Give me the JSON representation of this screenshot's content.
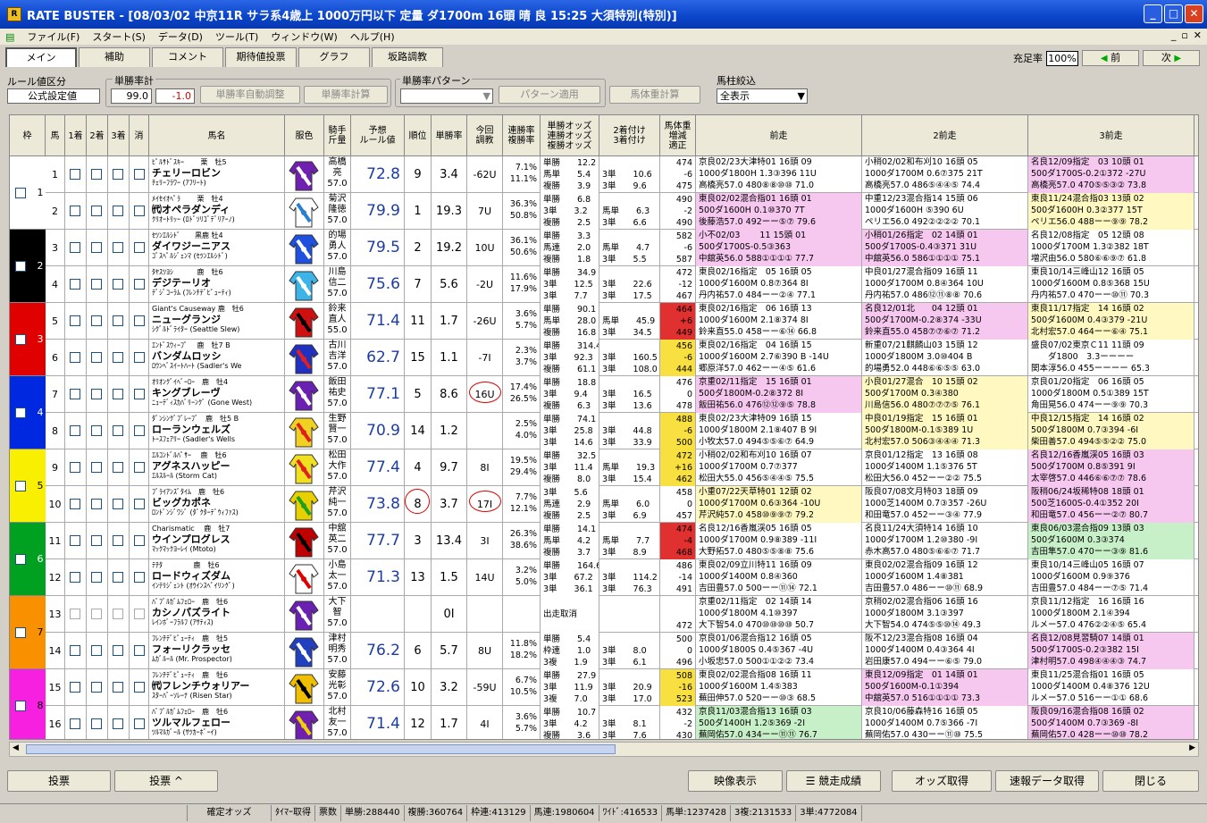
{
  "title": "RATE BUSTER - [08/03/02 中京11R サラ系4歳上 1000万円以下 定量 ダ1700m 16頭 晴 良 15:25 大須特別(特別)]",
  "menu": [
    "ファイル(F)",
    "スタート(S)",
    "データ(D)",
    "ツール(T)",
    "ウィンドウ(W)",
    "ヘルプ(H)"
  ],
  "tabs": [
    "メイン",
    "補助",
    "コメント",
    "期待値投票",
    "グラフ",
    "坂路調教"
  ],
  "fill_label": "充足率",
  "fill_value": "100%",
  "prev_label": "前",
  "next_label": "次",
  "rule_label": "ルール値区分",
  "rule_value": "公式設定値",
  "winrate_total_label": "単勝率計",
  "winrate_total": "99.0",
  "winrate_diff": "-1.0",
  "auto_adjust": "単勝率自動調整",
  "winrate_calc": "単勝率計算",
  "pattern_label": "単勝率パターン",
  "pattern_apply": "パターン適用",
  "weight_calc": "馬体重計算",
  "filter_label": "馬柱絞込",
  "filter_value": "全表示",
  "headers": {
    "waku": "枠",
    "uma": "馬",
    "p1": "1着",
    "p2": "2着",
    "p3": "3着",
    "kesi": "消",
    "name": "馬名",
    "silk": "服色",
    "jockey": "騎手\n斤量",
    "rule": "予想\nルール値",
    "rank": "順位",
    "win": "単勝率",
    "chokyo": "今回\n調教",
    "rentan": "連勝率\n複勝率",
    "odds": "単勝オッズ\n連勝オッズ\n複勝オッズ",
    "odds2": "2着付け\n3着付け",
    "weight": "馬体重\n増減\n適正",
    "prev1": "前走",
    "prev2": "2前走",
    "prev3": "3前走"
  },
  "horses": [
    {
      "no": "1",
      "sire": "ﾋﾟﾙｻﾄﾞｽｷｰ　　 栗　牡5",
      "name": "チェリーロビン",
      "dam": "ﾁｪﾘｰﾌﾗﾜｰ (ｱﾌﾘｰﾄ)",
      "jockey": "高橋\n亮\n57.0",
      "rule": "72.8",
      "rank": "9",
      "win": "3.4",
      "chokyo": "-62U",
      "rentan": "7.1%\n11.1%",
      "odds": "単勝　　12.2\n馬単　　5.4\n複勝　　3.9",
      "odds2": "\n3単　　10.6\n3単　　9.6",
      "weight": "474\n-6\n475",
      "p1": "京良02/23大津特01 16頭 09\n1000ダ1800H 1.3③396 11U\n高橋亮57.0 480⑧⑧⑩⑩ 71.0",
      "p2": "小稍02/02和布刈10 16頭 05\n1000ダ1700M 0.6⑦375 21T\n高橋亮57.0 486⑤④④⑤ 74.4",
      "p3": "名良12/09指定　03 10頭 01\n500ダ1700S-0.2①372 -27U\n高橋亮57.0 470⑤⑤③② 73.8",
      "c1": "",
      "c2": "",
      "c3": "#f6c8f0"
    },
    {
      "no": "2",
      "sire": "ﾒｲｾｲｵﾍﾟﾗ　　 栗　牡4",
      "name": "㈹オペラダンディ",
      "dam": "ｸﾘｵｰﾄﾘｯｰ (ﾛﾄﾞｿﾘｺﾞﾃﾞﾘｱｰﾉ)",
      "jockey": "菊沢\n隆徳\n57.0",
      "rule": "79.9",
      "rank": "1",
      "win": "19.3",
      "chokyo": "7U",
      "rentan": "36.3%\n50.8%",
      "odds": "単勝　　6.8\n3単　　3.2\n複勝　　2.5",
      "odds2": "\n馬単　　6.3\n3単　　6.6",
      "weight": "490\n-2\n490",
      "p1": "東良02/02混合指01 16頭 01\n500ダ1600H 0.1⑩370 7T\n後藤浩57.0 492ーー⑤⑦ 79.6",
      "p2": "中重12/23混合指14 15頭 06\n1000ダ1600H ⑤390 6U\nペリエ56.0 492②②②② 70.1",
      "p3": "東良11/24混合指03 13頭 02\n500ダ1600H 0.3②377 15T\nペリエ56.0 488ーー⑨⑨ 78.2",
      "c1": "#f6c8f0",
      "c2": "",
      "c3": "#fff8c0"
    },
    {
      "no": "3",
      "sire": "ｾﾂﾝｴﾙｼﾄﾞ　　黒鹿 牡4",
      "name": "ダイワジーニアス",
      "dam": "ｺﾞｽﾍﾟﾙｼﾞｪﾝﾏ (ｾﾂﾝｴﾙｼﾄﾞ)",
      "jockey": "的場\n勇人\n57.0",
      "rule": "79.5",
      "rank": "2",
      "win": "19.2",
      "chokyo": "10U",
      "rentan": "36.1%\n50.6%",
      "odds": "単勝　　3.3\n馬連　　2.0\n複勝　　1.8",
      "odds2": "\n馬単　　4.7\n3単　　5.5",
      "weight": "582\n-6\n587",
      "p1": "小不02/03　　 11 15頭 01\n500ダ1700S-0.5③363\n中舘英56.0 588①①①① 77.7",
      "p2": "小稍01/26指定　02 14頭 01\n500ダ1700S-0.4③371 31U\n中舘英56.0 586①①①① 75.1",
      "p3": "名良12/08指定　05 12頭 08\n1000ダ1700M 1.3②382 18T\n増沢由56.0 580⑥⑥⑨⑦ 61.8",
      "c1": "#f6c8f0",
      "c2": "#f6c8f0",
      "c3": ""
    },
    {
      "no": "4",
      "sire": "ﾀﾔｽﾂﾖｼ　　　 鹿　牡6",
      "name": "デジテーリオ",
      "dam": "ﾃﾞｼﾞｺｰﾗﾑ (ﾌﾚﾝﾁﾃﾞﾋﾟｭｰﾃｨ)",
      "jockey": "川島\n信二\n57.0",
      "rule": "75.6",
      "rank": "7",
      "win": "5.6",
      "chokyo": "-2U",
      "rentan": "11.6%\n17.9%",
      "odds": "単勝　　34.9\n3単　　12.5\n3単　　7.7",
      "odds2": "\n3単　　22.6\n3単　　17.5",
      "weight": "472\n-12\n467",
      "p1": "東良02/16指定　05 16頭 05\n1000ダ1600M 0.8⑦364 8I\n丹内祐57.0 484ーー②④ 77.1",
      "p2": "中良01/27混合指09 16頭 11\n1000ダ1700M 0.8④364 10U\n丹内祐57.0 486⑫⑪⑧⑧ 70.6",
      "p3": "東良10/14三峰山12 16頭 05\n1000ダ1600M 0.8⑤368 15U\n丹内祐57.0 470ーー⑩⑪ 70.3",
      "c1": "",
      "c2": "",
      "c3": ""
    },
    {
      "no": "5",
      "sire": "Giant's Causeway 鹿　牡6",
      "name": "ニューグランジ",
      "dam": "ｼｸﾞﾙﾄﾞﾗｲﾀｰ (Seattle Slew)",
      "jockey": "鈴来\n直人\n55.0",
      "rule": "71.4",
      "rank": "11",
      "win": "1.7",
      "chokyo": "-26U",
      "rentan": "3.6%\n5.7%",
      "odds": "単勝　　90.1\n馬単　　28.0\n複勝　　16.8",
      "odds2": "\n馬単　　45.9\n3単　　34.5",
      "weight": "464\n+6\n449",
      "p1": "東良02/16指定　06 16頭 13\n1000ダ1600M 2.1⑧374 8I\n鈴来直55.0 458ーー⑥⑭ 66.8",
      "p2": "名良12/01北　　04 12頭 01\n500ダ1700M-0.2⑧374 -33U\n鈴来直55.0 458⑦⑦⑥⑦ 71.2",
      "p3": "東良11/17指定　14 16頭 02\n500ダ1600M 0.4③379 -21U\n北村宏57.0 464ーー⑥④ 75.1",
      "c1": "",
      "c2": "#f6c8f0",
      "c3": "#fff8c0",
      "wc": "#e03030"
    },
    {
      "no": "6",
      "sire": "ｴﾝﾄﾞｽｳｨｰﾌﾟ　 鹿　牡7 B",
      "name": "バンダムロッシ",
      "dam": "ﾛｳﾝﾍﾞｽｲｰﾄﾊｰﾄ (Sadler's We",
      "jockey": "古川\n吉洋\n57.0",
      "rule": "62.7",
      "rank": "15",
      "win": "1.1",
      "chokyo": "-7I",
      "rentan": "2.3%\n3.7%",
      "odds": "単勝　　314.4\n3単　　92.3\n複勝　　61.1",
      "odds2": "\n3単　　160.5\n3単　　108.0",
      "weight": "456\n-6\n444",
      "p1": "東良02/16指定　04 16頭 15\n1000ダ1600M 2.7⑥390 B -14U\n郷原洋57.0 462ーー④⑤ 61.6",
      "p2": "新重07/21麒麟山03 15頭 12\n1000ダ1800M 3.0⑩404 B\n的場勇52.0 448⑥⑥⑤⑤ 63.0",
      "p3": "盛良07/02東京Ｃ11 11頭 09\n　　ダ1800　3.3ーーーー\n関本淳56.0 455ーーーー 65.3",
      "c1": "",
      "c2": "",
      "c3": "",
      "wc": "#f8e040"
    },
    {
      "no": "7",
      "sire": "ｵﾘｵﾝｸﾞｲﾍﾞｰﾛｰ　鹿　牡4",
      "name": "キングブレーヴ",
      "dam": "ﾆｭｰﾃﾞｨｽｶﾊﾞﾘｰﾝｸﾞ (Gone West)",
      "jockey": "飯田\n祐史\n57.0",
      "rule": "77.1",
      "rank": "5",
      "win": "8.6",
      "chokyo": "16U",
      "rentan": "17.4%\n26.5%",
      "odds": "単勝　　18.8\n3単　　9.4\n複勝　　6.3",
      "odds2": "\n3単　　16.5\n3単　　13.6",
      "weight": "476\n0\n478",
      "p1": "京重02/11指定　15 16頭 01\n500ダ1800M-0.2⑧372 8I\n飯田祐56.0 476⑫⑫⑨⑤ 78.8",
      "p2": "小良01/27混合　10 15頭 02\n500ダ1700M 0.3④380\n川島信56.0 480⑦⑦⑦⑤ 76.1",
      "p3": "京良01/20指定　06 16頭 05\n1000ダ1800M 0.5①389 15T\n角田晃56.0 474ーー⑨⑨ 70.3",
      "c1": "#f6c8f0",
      "c2": "#fff8c0",
      "c3": ""
    },
    {
      "no": "8",
      "sire": "ﾀﾞﾝｼﾝｸﾞﾌﾞﾚｰﾌﾞ　鹿　牡5 B",
      "name": "ローランウェルズ",
      "dam": "ﾄｰｽﾌｪｱﾘｰ (Sadler's Wells",
      "jockey": "生野\n賢一\n57.0",
      "rule": "70.9",
      "rank": "14",
      "win": "1.2",
      "chokyo": "",
      "rentan": "2.5%\n4.0%",
      "odds": "単勝　　74.1\n3単　　25.8\n3単　　14.6",
      "odds2": "\n3単　　44.8\n3単　　33.9",
      "weight": "488\n-6\n500",
      "p1": "東良02/23大津特09 16頭 15\n1000ダ1800M 2.1⑧407 B 9I\n小牧太57.0 494⑤⑤⑥⑦ 64.9",
      "p2": "中良01/19指定　15 16頭 01\n500ダ1800M-0.1⑤389 1U\n北村宏57.0 506③④④④ 71.3",
      "p3": "中良12/15指定　14 16頭 02\n500ダ1800M 0.7③394 -6I\n柴田善57.0 494⑤⑤②② 75.0",
      "c1": "",
      "c2": "#fff8c0",
      "c3": "#fff8c0",
      "wc": "#f8e040"
    },
    {
      "no": "9",
      "sire": "ｴﾙｺﾝﾄﾞﾙﾊﾟｻｰ　 鹿　牡6",
      "name": "アグネスハッピー",
      "dam": "ｴﾙｽﾙｰﾙ (Storm Cat)",
      "jockey": "松田\n大作\n57.0",
      "rule": "77.4",
      "rank": "4",
      "win": "9.7",
      "chokyo": "8I",
      "rentan": "19.5%\n29.4%",
      "odds": "単勝　　32.5\n3単　　11.4\n複勝　　8.0",
      "odds2": "\n馬単　　19.3\n3単　　15.4",
      "weight": "472\n+16\n462",
      "p1": "小稍02/02和布刈10 16頭 07\n1000ダ1700M 0.7⑦377\n松田大55.0 456⑤④④⑤ 75.5",
      "p2": "京良01/12指定　13 16頭 08\n1000ダ1400M 1.1⑤376 5T\n松田大56.0 452ーー②② 75.5",
      "p3": "名良12/16香嵐渓05 16頭 03\n500ダ1700M 0.8⑤391 9I\n太宰啓57.0 446⑥⑥⑦⑦ 78.6",
      "c1": "",
      "c2": "",
      "c3": "#f6c8f0",
      "wc": "#f8e040"
    },
    {
      "no": "10",
      "sire": "ﾌﾞﾗｲｱﾝｽﾞﾀｲﾑ　鹿　牡6",
      "name": "ビッグカポネ",
      "dam": "ﾛﾝﾄﾞﾝｼﾞﾜｼﾞ (ﾀﾞｸﾀｰﾃﾞｳｨﾌｧｽ)",
      "jockey": "芹沢\n純一\n57.0",
      "rule": "73.8",
      "rank": "8",
      "win": "3.7",
      "chokyo": "17I",
      "rentan": "7.7%\n12.1%",
      "odds": "3単　　5.6\n馬連　　2.9\n複勝　　2.5",
      "odds2": "\n馬単　　6.0\n3単　　6.9",
      "weight": "458\n0\n457",
      "p1": "小重07/22天草特01 12頭 02\n1000ダ1700M 0.6③364 -10U\n芹沢純57.0 458⑩⑨⑨⑦ 79.2",
      "p2": "阪良07/08文月特03 18頭 09\n1000芝1400M 0.7③357 -26U\n和田竜57.0 452ーー③④ 77.9",
      "p3": "阪稍06/24坂稀特08 18頭 01\n500芝1600S-0.4①352 20I\n和田竜57.0 456ーー②⑦ 80.7",
      "c1": "#fff8c0",
      "c2": "",
      "c3": "#f6c8f0"
    },
    {
      "no": "11",
      "sire": "Charismatic　 鹿　牡7",
      "name": "ウインプログレス",
      "dam": "ﾏｯｸﾏｯｸﾖｰﾚｲ (Mtoto)",
      "jockey": "中舘\n英二\n57.0",
      "rule": "77.7",
      "rank": "3",
      "win": "13.4",
      "chokyo": "3I",
      "rentan": "26.3%\n38.6%",
      "odds": "単勝　　14.1\n馬単　　4.2\n複勝　　3.7",
      "odds2": "\n馬単　　7.7\n3単　　8.9",
      "weight": "474\n-4\n468",
      "p1": "名良12/16香嵐渓05 16頭 05\n1000ダ1700M 0.9⑧389 -11I\n大野拓57.0 480⑤⑤⑧⑧ 75.6",
      "p2": "名良11/24大須特14 16頭 10\n1000ダ1700M 1.2⑩380 -9I\n赤木高57.0 480⑤⑥⑥⑦ 71.7",
      "p3": "東良06/03混合指09 13頭 03\n500ダ1600M 0.3③374\n吉田隼57.0 470ーー③⑨ 81.6",
      "c1": "",
      "c2": "",
      "c3": "#c8f0c8",
      "wc": "#e03030"
    },
    {
      "no": "12",
      "sire": "ﾃﾁﾀ　　　　 鹿　牡6",
      "name": "ロードウィズダム",
      "dam": "ｲﾝﾃﾘｼﾞｪﾝﾄ (ｵｳｲﾝｽﾍﾟｲﾘﾝｸﾞ)",
      "jockey": "小島\n太一\n57.0",
      "rule": "71.3",
      "rank": "13",
      "win": "1.5",
      "chokyo": "14U",
      "rentan": "3.2%\n5.0%",
      "odds": "単勝　　164.6\n3単　　67.2\n3単　　36.1",
      "odds2": "\n3単　　114.2\n3単　　76.3",
      "weight": "486\n-14\n491",
      "p1": "東良02/09立川特11 16頭 09\n1000ダ1400M 0.8④360\n吉田豊57.0 500ーー⑪⑭ 72.1",
      "p2": "東良02/02混合指09 16頭 12\n1000ダ1600M 1.4⑧381\n吉田豊57.0 486ーー⑩⑪ 68.9",
      "p3": "東良10/14三峰山05 16頭 07\n1000ダ1600M 0.9⑨376\n吉田豊57.0 484ーー⑦⑤ 71.4",
      "c1": "",
      "c2": "",
      "c3": ""
    },
    {
      "no": "13",
      "sire": "ﾊﾞﾌﾞﾙｶﾞﾑﾌｪﾛｰ　鹿　牡6",
      "name": "カシノパズライト",
      "dam": "ﾚｲﾝﾎﾞｰﾌﾗﾙﾌ (ｱｻﾃｨｽ)",
      "jockey": "大下\n智\n57.0",
      "rule": "",
      "rank": "",
      "win": "0I",
      "chokyo": "",
      "rentan": "",
      "odds": "\n出走取消",
      "odds2": "",
      "weight": "\n\n472",
      "p1": "京重02/11指定　02 14頭 14\n1000ダ1800M 4.1⑩397\n大下智54.0 470⑩⑩⑩⑩ 50.7",
      "p2": "京稍02/02混合指06 16頭 16\n1000ダ1800M 3.1③397\n大下智54.0 474⑤⑤⑩⑭ 49.3",
      "p3": "京良11/12指定　16 16頭 16\n1000ダ1800M 2.1④394\nルメー57.0 476②②④⑤ 65.4",
      "c1": "",
      "c2": "",
      "c3": "",
      "disabled": true
    },
    {
      "no": "14",
      "sire": "ﾌﾚﾝﾁﾃﾞﾋﾟｭｰﾃｨ　鹿　牡5",
      "name": "フォーリクラッセ",
      "dam": "ﾑｶﾞﾙｰﾙ (Mr. Prospector)",
      "jockey": "津村\n明秀\n57.0",
      "rule": "76.2",
      "rank": "6",
      "win": "5.7",
      "chokyo": "8U",
      "rentan": "11.8%\n18.2%",
      "odds": "単勝　　5.4\n枠連　　1.0\n3複　　1.9",
      "odds2": "\n3単　　8.0\n3単　　6.1",
      "weight": "500\n0\n496",
      "p1": "京良01/06混合指12 16頭 05\n1000ダ1800S 0.4⑤367 -4U\n小坂忠57.0 500①①②② 73.4",
      "p2": "阪不12/23混合指08 16頭 04\n1000ダ1400M 0.4③364 4I\n岩田康57.0 494ーー⑥⑤ 79.0",
      "p3": "名良12/08見習騎07 14頭 01\n500ダ1700S-0.2③382 15I\n津村明57.0 498④④④③ 74.7",
      "c1": "",
      "c2": "",
      "c3": "#f6c8f0"
    },
    {
      "no": "15",
      "sire": "ﾌﾚﾝﾁﾃﾞﾋﾟｭｰﾃｨ　鹿　牡6",
      "name": "㈹フレンチウォリアー",
      "dam": "ｽﾀｰﾊﾞｰｿﾚｰﾅ (Risen Star)",
      "jockey": "安藤\n光彰\n57.0",
      "rule": "72.6",
      "rank": "10",
      "win": "3.2",
      "chokyo": "-59U",
      "rentan": "6.7%\n10.5%",
      "odds": "単勝　　27.9\n3単　　11.9\n3複　　7.0",
      "odds2": "\n3単　　20.9\n3単　　17.0",
      "weight": "508\n-16\n523",
      "p1": "東良02/02混合指08 16頭 11\n1000ダ1600M 1.4⑤383\n蕪田伸57.0 520ーー⑩③ 68.5",
      "p2": "東良12/09指定　01 14頭 01\n500ダ1600M-0.1①394\n中舘英57.0 516①①①① 73.3",
      "p3": "東良11/25混合指01 16頭 05\n1000ダ1400M 0.4⑧376 12U\nルメー57.0 516ーー①① 68.6",
      "c1": "",
      "c2": "#f6c8f0",
      "c3": "",
      "wc": "#f8e040"
    },
    {
      "no": "16",
      "sire": "ﾊﾞﾌﾞﾙｶﾞﾑﾌｪﾛｰ　鹿　牡6",
      "name": "ツルマルフェロー",
      "dam": "ﾂﾙﾏﾙｶﾞｰﾙ (ｻﾂｶｰﾎﾞｰｲ)",
      "jockey": "北村\n友一\n57.0",
      "rule": "71.4",
      "rank": "12",
      "win": "1.7",
      "chokyo": "4I",
      "rentan": "3.6%\n5.7%",
      "odds": "単勝　　10.7\n3単　　4.2\n複勝　　3.6",
      "odds2": "\n3単　　8.1\n3単　　7.6",
      "weight": "432\n-2\n430",
      "p1": "京良11/03混合指13 16頭 03\n500ダ1400H 1.2⑤369 -2I\n蕪岡佑57.0 434ーー⑪⑪ 76.7",
      "p2": "京良10/06藤森特16 16頭 05\n1000ダ1400M 0.7⑤366 -7I\n蕪岡佑57.0 430ーー⑪⑩ 75.5",
      "p3": "阪良09/16混合指08 16頭 02\n500ダ1400M 0.7③369 -8I\n蕪岡佑57.0 428ーー⑩⑩ 78.2",
      "c1": "#c8f0c8",
      "c2": "",
      "c3": "#f6c8f0"
    }
  ],
  "waku": [
    {
      "n": "1",
      "bg": "#ffffff",
      "fg": "#000"
    },
    {
      "n": "2",
      "bg": "#000000",
      "fg": "#fff"
    },
    {
      "n": "3",
      "bg": "#e00000",
      "fg": "#fff"
    },
    {
      "n": "4",
      "bg": "#0028e0",
      "fg": "#fff"
    },
    {
      "n": "5",
      "bg": "#f8f000",
      "fg": "#000"
    },
    {
      "n": "6",
      "bg": "#00a020",
      "fg": "#fff"
    },
    {
      "n": "7",
      "bg": "#f89000",
      "fg": "#000"
    },
    {
      "n": "8",
      "bg": "#f820e0",
      "fg": "#000"
    }
  ],
  "buttons": {
    "vote": "投票",
    "vote2": "投票 ^",
    "video": "映像表示",
    "results": "競走成績",
    "odds_get": "オッズ取得",
    "quick": "速報データ取得",
    "close": "閉じる"
  },
  "status": [
    "",
    "確定オッズ",
    "ﾀｲﾏｰ取得",
    "票数",
    "単勝:288440",
    "複勝:360764",
    "枠連:413129",
    "馬連:1980604",
    "ﾜｲﾄﾞ:416533",
    "馬単:1237428",
    "3複:2131533",
    "3単:4772084"
  ]
}
